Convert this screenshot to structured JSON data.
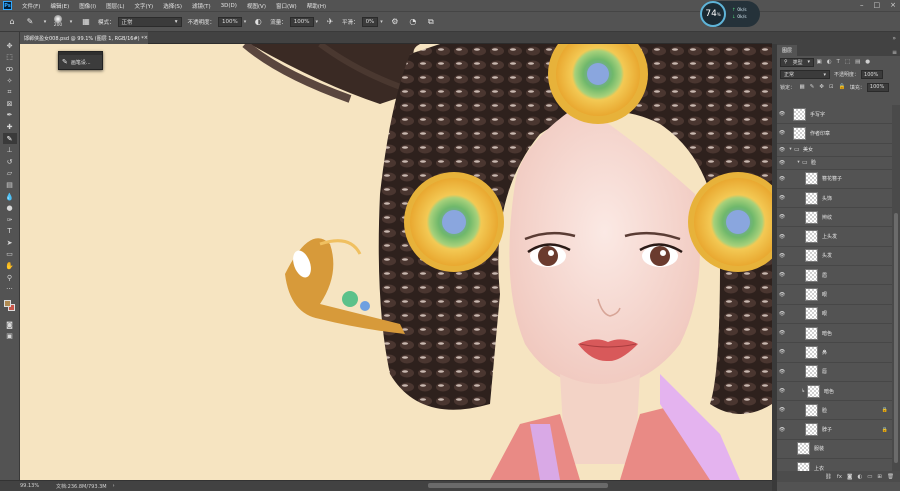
{
  "menubar": {
    "logo": "Ps",
    "items": [
      "文件(F)",
      "编辑(E)",
      "图像(I)",
      "图层(L)",
      "文字(Y)",
      "选择(S)",
      "滤镜(T)",
      "3D(D)",
      "视图(V)",
      "窗口(W)",
      "帮助(H)"
    ]
  },
  "options": {
    "brush_size": "200",
    "mode_label": "模式：",
    "mode_value": "正常",
    "opacity_label": "不透明度：",
    "opacity_value": "100%",
    "flow_label": "流量：",
    "flow_value": "100%",
    "smooth_label": "平滑：",
    "smooth_value": "0%"
  },
  "perf": {
    "percent": "74",
    "unit": "%",
    "upload": "0k/s",
    "download": "0k/s"
  },
  "document": {
    "tab_title": "邯郸侠盈女008.psd @ 99.1% (图层 1, RGB/16#) *",
    "tab_close": "×"
  },
  "brush_popup": {
    "label": "画笔设..."
  },
  "status": {
    "zoom": "99.13%",
    "doc_info": "文档:236.8M/793.3M"
  },
  "layers_panel": {
    "tab": "图层",
    "filter_kind": "类型",
    "blend_mode": "正常",
    "opacity_label": "不透明度：",
    "opacity_value": "100%",
    "lock_label": "锁定：",
    "fill_label": "填充：",
    "fill_value": "100%",
    "layers": [
      {
        "name": "手写字",
        "depth": 0,
        "type": "layer"
      },
      {
        "name": "作者印章",
        "depth": 0,
        "type": "layer"
      },
      {
        "name": "美女",
        "depth": 0,
        "type": "group"
      },
      {
        "name": "脸",
        "depth": 1,
        "type": "group"
      },
      {
        "name": "簪花簪子",
        "depth": 2,
        "type": "layer"
      },
      {
        "name": "头饰",
        "depth": 2,
        "type": "layer"
      },
      {
        "name": "辫纹",
        "depth": 2,
        "type": "layer"
      },
      {
        "name": "上头发",
        "depth": 2,
        "type": "layer"
      },
      {
        "name": "头发",
        "depth": 2,
        "type": "layer"
      },
      {
        "name": "眉",
        "depth": 2,
        "type": "layer"
      },
      {
        "name": "眼",
        "depth": 2,
        "type": "layer"
      },
      {
        "name": "眼",
        "depth": 2,
        "type": "layer"
      },
      {
        "name": "暗色",
        "depth": 2,
        "type": "layer"
      },
      {
        "name": "鼻",
        "depth": 2,
        "type": "layer"
      },
      {
        "name": "唇",
        "depth": 2,
        "type": "layer"
      },
      {
        "name": "暗色",
        "depth": 2,
        "type": "clipped"
      },
      {
        "name": "脸",
        "depth": 2,
        "type": "locked"
      },
      {
        "name": "脖子",
        "depth": 2,
        "type": "locked"
      },
      {
        "name": "服装",
        "depth": 1,
        "type": "layer"
      },
      {
        "name": "上衣",
        "depth": 1,
        "type": "layer"
      }
    ]
  }
}
